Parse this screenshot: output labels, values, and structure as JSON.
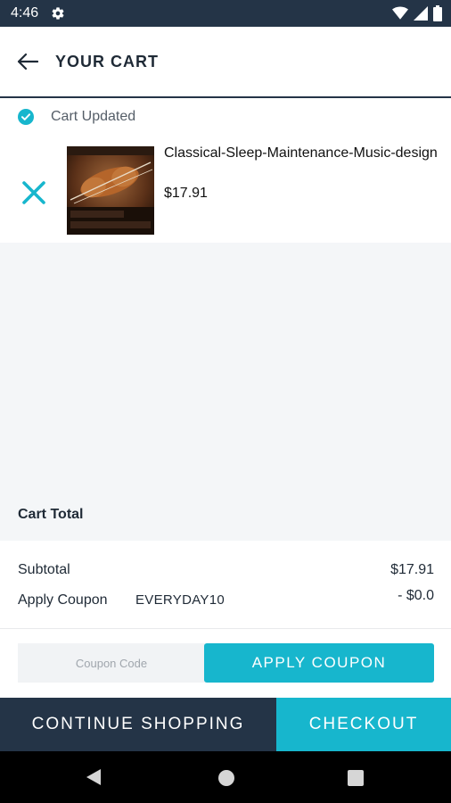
{
  "status_bar": {
    "time": "4:46"
  },
  "header": {
    "title": "YOUR CART"
  },
  "notice": {
    "text": "Cart Updated"
  },
  "cart_item": {
    "name": "Classical-Sleep-Maintenance-Music-design",
    "price": "$17.91",
    "thumb_caption_1": "J. Sebastian Bach",
    "thumb_caption_2": "Classical Sleep Maintenance Music"
  },
  "totals": {
    "section_label": "Cart Total",
    "subtotal_label": "Subtotal",
    "subtotal_value": "$17.91",
    "coupon_label": "Apply Coupon",
    "coupon_code": "EVERYDAY10",
    "coupon_discount": "- $0.0"
  },
  "coupon": {
    "placeholder": "Coupon Code",
    "button_label": "APPLY COUPON"
  },
  "actions": {
    "continue_label": "CONTINUE SHOPPING",
    "checkout_label": "CHECKOUT"
  },
  "colors": {
    "primary_dark": "#243447",
    "accent": "#17b6cd"
  },
  "icons": {
    "back": "arrow-left-icon",
    "notice": "check-circle-icon",
    "remove": "close-icon"
  }
}
